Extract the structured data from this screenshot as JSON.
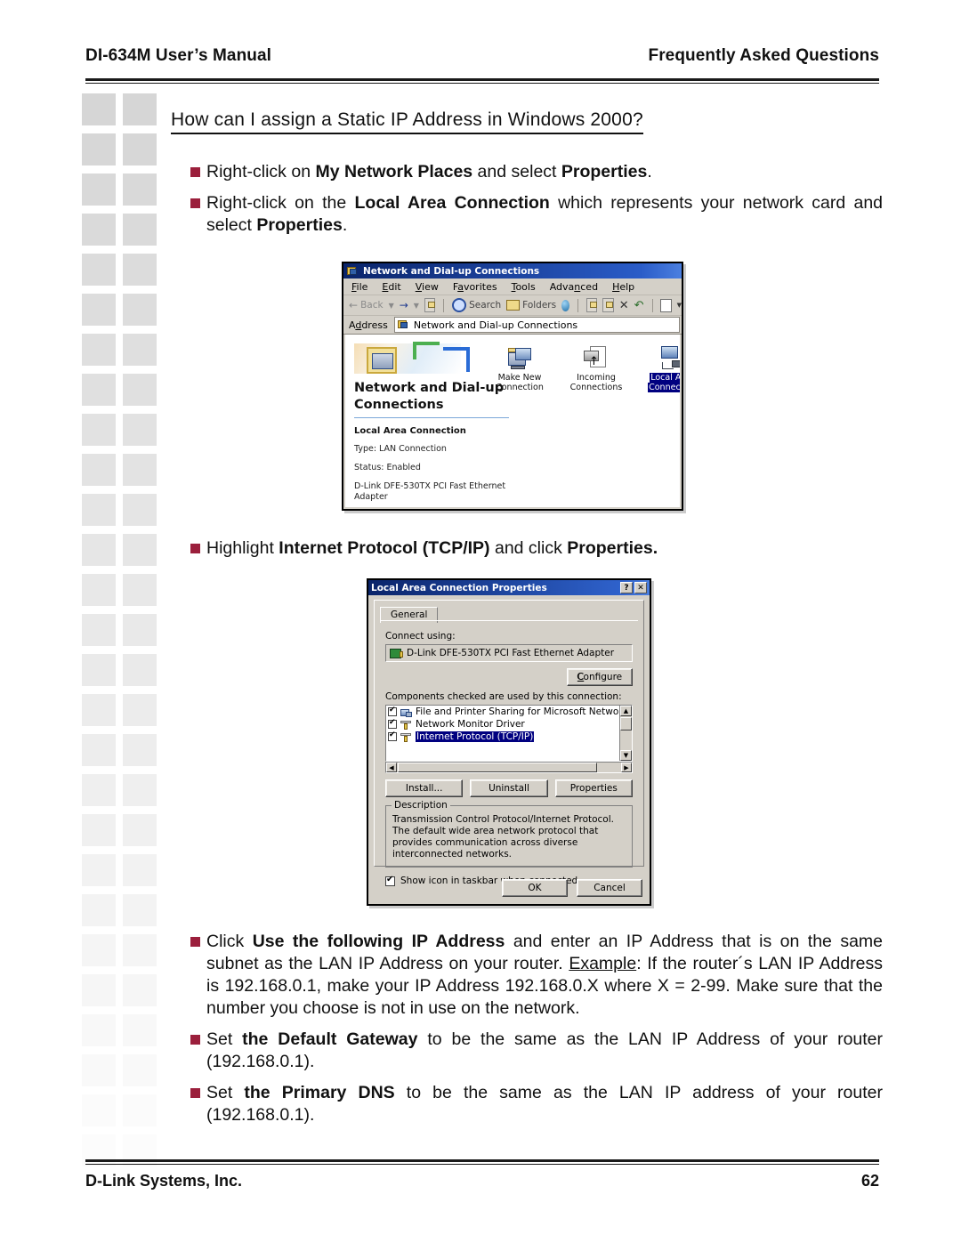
{
  "header": {
    "left": "DI-634M User’s Manual",
    "right": "Frequently Asked Questions"
  },
  "footer": {
    "left": "D-Link Systems, Inc.",
    "page": "62"
  },
  "heading": "How can I assign a Static IP Address in Windows 2000?",
  "colors": {
    "bullet": "#9B1F3C",
    "title_bar": "#0A246A",
    "dialog_face": "#D4D0C8",
    "selection": "#000080"
  },
  "bullets": {
    "b1_pre": "Right-click on ",
    "b1_b1": "My Network Places",
    "b1_mid": " and select ",
    "b1_b2": "Properties",
    "b1_post": ".",
    "b2_pre": "Right-click on the ",
    "b2_b1": "Local Area Connection",
    "b2_mid": " which represents your network card and select ",
    "b2_b2": "Properties",
    "b2_post": ".",
    "b3_pre": "Highlight ",
    "b3_b1": "Internet Protocol (TCP/IP)",
    "b3_mid": " and click ",
    "b3_b2": "Properties.",
    "b4_pre": "Click ",
    "b4_b1": "Use the following IP Address",
    "b4_mid": " and enter an IP Address that is on the same subnet as the LAN IP Address on your router. ",
    "b4_u": "Example",
    "b4_post": ": If the router´s LAN IP Address is 192.168.0.1, make your IP Address 192.168.0.X where X = 2-99. Make sure that the number you choose is not in use on the network.",
    "b5_pre": "Set ",
    "b5_b1": "the Default Gateway",
    "b5_post": " to be the same as the LAN IP Address of your router (192.168.0.1).",
    "b6_pre": "Set ",
    "b6_b1": "the Primary DNS",
    "b6_post": " to be the same as the LAN IP address of your router (192.168.0.1)."
  },
  "window1": {
    "title": "Network and Dial-up Connections",
    "menu": [
      "File",
      "Edit",
      "View",
      "Favorites",
      "Tools",
      "Advanced",
      "Help"
    ],
    "toolbar": {
      "back": "Back",
      "search": "Search",
      "folders": "Folders"
    },
    "address_label": "Address",
    "address_value": "Network and Dial-up Connections",
    "banner_line1": "Network and Dial-up",
    "banner_line2": "Connections",
    "detail_title": "Local Area Connection",
    "detail_type": "Type: LAN Connection",
    "detail_status": "Status: Enabled",
    "detail_adapter": "D-Link DFE-530TX PCI Fast Ethernet Adapter",
    "items": [
      {
        "line1": "Make New",
        "line2": "Connection",
        "selected": false
      },
      {
        "line1": "Incoming",
        "line2": "Connections",
        "selected": false
      },
      {
        "line1": "Local Area",
        "line2": "Connection",
        "selected": true
      }
    ]
  },
  "window2": {
    "title": "Local Area Connection Properties",
    "help_btn": "?",
    "close_btn": "✕",
    "tab": "General",
    "connect_using_label": "Connect using:",
    "adapter": "D-Link DFE-530TX PCI Fast Ethernet Adapter",
    "configure_btn": "Configure",
    "components_label": "Components checked are used by this connection:",
    "components": [
      {
        "label": "File and Printer Sharing for Microsoft Networks",
        "checked": true,
        "selected": false,
        "icon": "computer-icon"
      },
      {
        "label": "Network Monitor Driver",
        "checked": true,
        "selected": false,
        "icon": "driver-icon"
      },
      {
        "label": "Internet Protocol (TCP/IP)",
        "checked": true,
        "selected": true,
        "icon": "driver-icon"
      }
    ],
    "install_btn": "Install...",
    "uninstall_btn": "Uninstall",
    "properties_btn": "Properties",
    "description_caption": "Description",
    "description_text": "Transmission Control Protocol/Internet Protocol. The default wide area network protocol that provides communication across diverse interconnected networks.",
    "show_icon_label": "Show icon in taskbar when connected",
    "ok_btn": "OK",
    "cancel_btn": "Cancel"
  }
}
